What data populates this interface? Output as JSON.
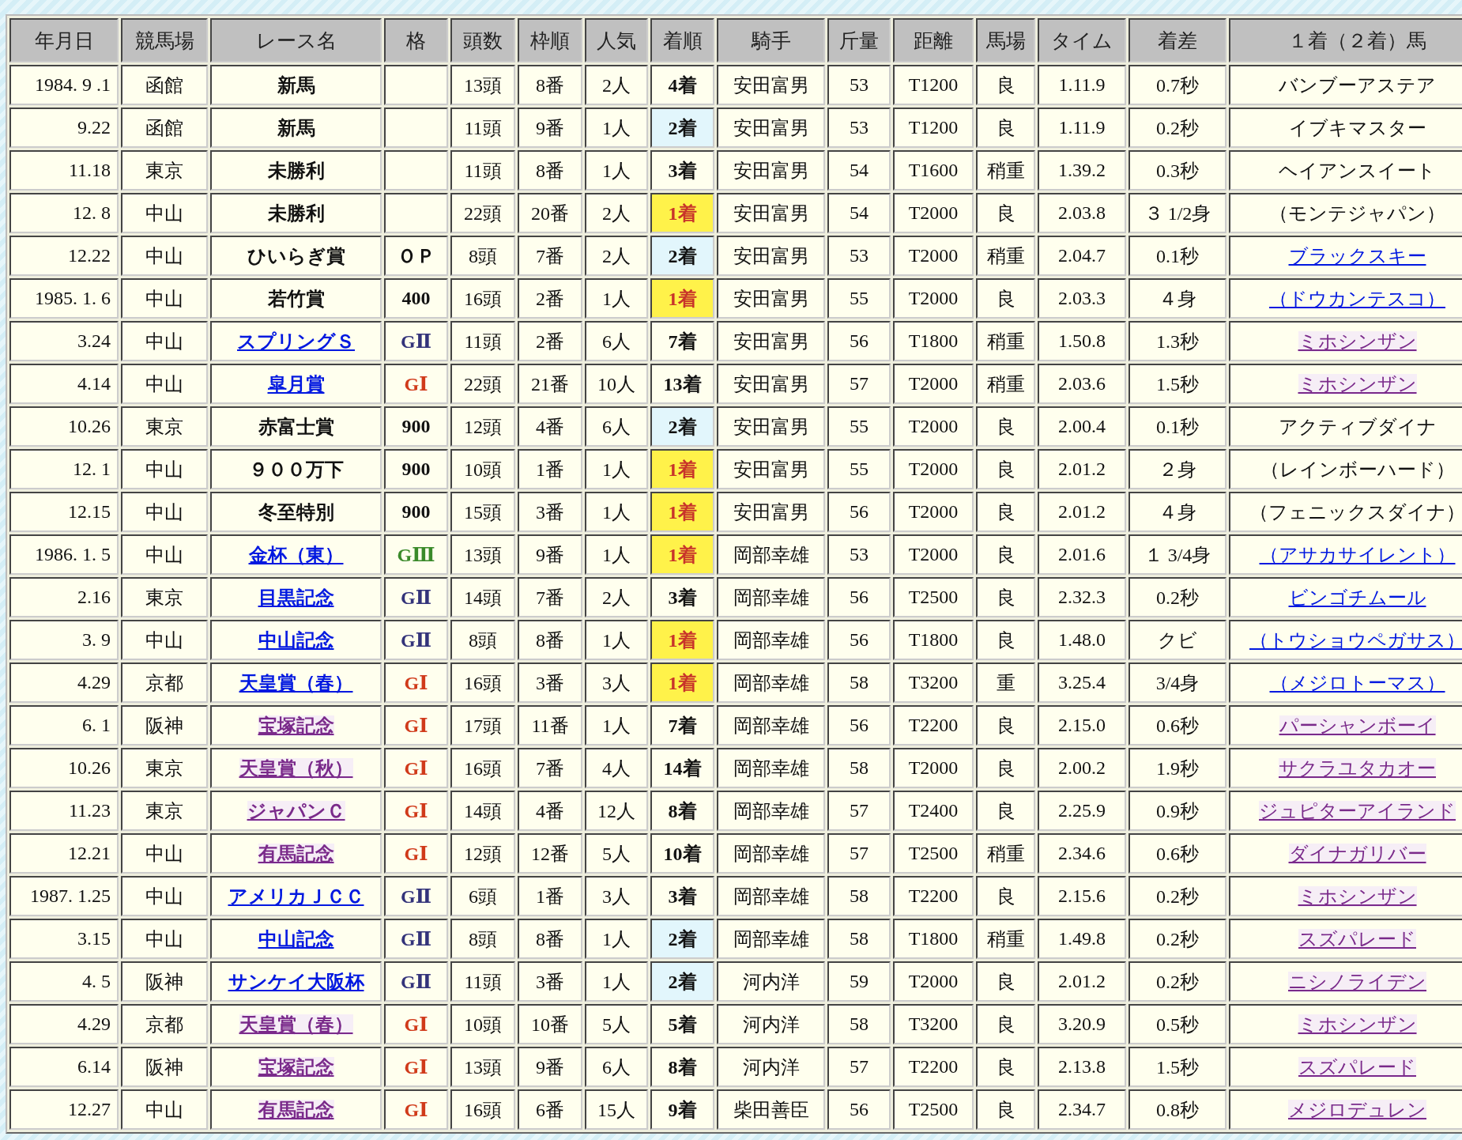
{
  "table": {
    "columns": [
      "年月日",
      "競馬場",
      "レース名",
      "格",
      "頭数",
      "枠順",
      "人気",
      "着順",
      "騎手",
      "斤量",
      "距離",
      "馬場",
      "タイム",
      "着差",
      "１着（２着）馬"
    ],
    "rows": [
      {
        "date": "1984. 9 .1",
        "course": "函館",
        "race": {
          "name": "新馬",
          "link": false
        },
        "runners": "13頭",
        "gate": "8番",
        "popularity": "2人",
        "finish": {
          "text": "4着",
          "kind": "plain"
        },
        "jockey": "安田富男",
        "weight": "53",
        "distance": "T1200",
        "going": "良",
        "time": "1.11.9",
        "margin": "0.7秒",
        "winner": {
          "name": "バンブーアステア",
          "link": false
        }
      },
      {
        "date": "9.22",
        "course": "函館",
        "race": {
          "name": "新馬",
          "link": false
        },
        "runners": "11頭",
        "gate": "9番",
        "popularity": "1人",
        "finish": {
          "text": "2着",
          "kind": "second"
        },
        "jockey": "安田富男",
        "weight": "53",
        "distance": "T1200",
        "going": "良",
        "time": "1.11.9",
        "margin": "0.2秒",
        "winner": {
          "name": "イブキマスター",
          "link": false
        }
      },
      {
        "date": "11.18",
        "course": "東京",
        "race": {
          "name": "未勝利",
          "link": false
        },
        "runners": "11頭",
        "gate": "8番",
        "popularity": "1人",
        "finish": {
          "text": "3着",
          "kind": "plain"
        },
        "jockey": "安田富男",
        "weight": "54",
        "distance": "T1600",
        "going": "稍重",
        "time": "1.39.2",
        "margin": "0.3秒",
        "winner": {
          "name": "ヘイアンスイート",
          "link": false
        }
      },
      {
        "date": "12. 8",
        "course": "中山",
        "race": {
          "name": "未勝利",
          "link": false
        },
        "runners": "22頭",
        "gate": "20番",
        "popularity": "2人",
        "finish": {
          "text": "1着",
          "kind": "win"
        },
        "jockey": "安田富男",
        "weight": "54",
        "distance": "T2000",
        "going": "良",
        "time": "2.03.8",
        "margin": "３ 1/2身",
        "winner": {
          "name": "（モンテジャパン）",
          "link": false
        }
      },
      {
        "date": "12.22",
        "course": "中山",
        "race": {
          "name": "ひいらぎ賞",
          "link": false
        },
        "grade": {
          "text": "ＯＰ",
          "kind": "plain"
        },
        "runners": "8頭",
        "gate": "7番",
        "popularity": "2人",
        "finish": {
          "text": "2着",
          "kind": "second"
        },
        "jockey": "安田富男",
        "weight": "53",
        "distance": "T2000",
        "going": "稍重",
        "time": "2.04.7",
        "margin": "0.1秒",
        "winner": {
          "name": "ブラックスキー",
          "link": true,
          "visited": false
        }
      },
      {
        "date": "1985. 1. 6",
        "course": "中山",
        "race": {
          "name": "若竹賞",
          "link": false
        },
        "grade": {
          "text": "400",
          "kind": "plain"
        },
        "runners": "16頭",
        "gate": "2番",
        "popularity": "1人",
        "finish": {
          "text": "1着",
          "kind": "win"
        },
        "jockey": "安田富男",
        "weight": "55",
        "distance": "T2000",
        "going": "良",
        "time": "2.03.3",
        "margin": "４身",
        "winner": {
          "name": "（ドウカンテスコ）",
          "link": true,
          "visited": false
        }
      },
      {
        "date": "3.24",
        "course": "中山",
        "race": {
          "name": "スプリングＳ",
          "link": true,
          "visited": false
        },
        "grade": {
          "text": "GⅡ",
          "kind": "g2"
        },
        "runners": "11頭",
        "gate": "2番",
        "popularity": "6人",
        "finish": {
          "text": "7着",
          "kind": "plain"
        },
        "jockey": "安田富男",
        "weight": "56",
        "distance": "T1800",
        "going": "稍重",
        "time": "1.50.8",
        "margin": "1.3秒",
        "winner": {
          "name": "ミホシンザン",
          "link": true,
          "visited": true
        }
      },
      {
        "date": "4.14",
        "course": "中山",
        "race": {
          "name": "皐月賞",
          "link": true,
          "visited": false
        },
        "grade": {
          "text": "GⅠ",
          "kind": "g1"
        },
        "runners": "22頭",
        "gate": "21番",
        "popularity": "10人",
        "finish": {
          "text": "13着",
          "kind": "plain"
        },
        "jockey": "安田富男",
        "weight": "57",
        "distance": "T2000",
        "going": "稍重",
        "time": "2.03.6",
        "margin": "1.5秒",
        "winner": {
          "name": "ミホシンザン",
          "link": true,
          "visited": true
        }
      },
      {
        "date": "10.26",
        "course": "東京",
        "race": {
          "name": "赤富士賞",
          "link": false
        },
        "grade": {
          "text": "900",
          "kind": "plain"
        },
        "runners": "12頭",
        "gate": "4番",
        "popularity": "6人",
        "finish": {
          "text": "2着",
          "kind": "second"
        },
        "jockey": "安田富男",
        "weight": "55",
        "distance": "T2000",
        "going": "良",
        "time": "2.00.4",
        "margin": "0.1秒",
        "winner": {
          "name": "アクティブダイナ",
          "link": false
        }
      },
      {
        "date": "12. 1",
        "course": "中山",
        "race": {
          "name": "９００万下",
          "link": false
        },
        "grade": {
          "text": "900",
          "kind": "plain"
        },
        "runners": "10頭",
        "gate": "1番",
        "popularity": "1人",
        "finish": {
          "text": "1着",
          "kind": "win"
        },
        "jockey": "安田富男",
        "weight": "55",
        "distance": "T2000",
        "going": "良",
        "time": "2.01.2",
        "margin": "２身",
        "winner": {
          "name": "（レインボーハード）",
          "link": false
        }
      },
      {
        "date": "12.15",
        "course": "中山",
        "race": {
          "name": "冬至特別",
          "link": false
        },
        "grade": {
          "text": "900",
          "kind": "plain"
        },
        "runners": "15頭",
        "gate": "3番",
        "popularity": "1人",
        "finish": {
          "text": "1着",
          "kind": "win"
        },
        "jockey": "安田富男",
        "weight": "56",
        "distance": "T2000",
        "going": "良",
        "time": "2.01.2",
        "margin": "４身",
        "winner": {
          "name": "（フェニックスダイナ）",
          "link": false
        }
      },
      {
        "date": "1986. 1. 5",
        "course": "中山",
        "race": {
          "name": "金杯（東）",
          "link": true,
          "visited": false
        },
        "grade": {
          "text": "GⅢ",
          "kind": "g3"
        },
        "runners": "13頭",
        "gate": "9番",
        "popularity": "1人",
        "finish": {
          "text": "1着",
          "kind": "win"
        },
        "jockey": "岡部幸雄",
        "weight": "53",
        "distance": "T2000",
        "going": "良",
        "time": "2.01.6",
        "margin": "１ 3/4身",
        "winner": {
          "name": "（アサカサイレント）",
          "link": true,
          "visited": false
        }
      },
      {
        "date": "2.16",
        "course": "東京",
        "race": {
          "name": "目黒記念",
          "link": true,
          "visited": false
        },
        "grade": {
          "text": "GⅡ",
          "kind": "g2"
        },
        "runners": "14頭",
        "gate": "7番",
        "popularity": "2人",
        "finish": {
          "text": "3着",
          "kind": "plain"
        },
        "jockey": "岡部幸雄",
        "weight": "56",
        "distance": "T2500",
        "going": "良",
        "time": "2.32.3",
        "margin": "0.2秒",
        "winner": {
          "name": "ビンゴチムール",
          "link": true,
          "visited": false
        }
      },
      {
        "date": "3. 9",
        "course": "中山",
        "race": {
          "name": "中山記念",
          "link": true,
          "visited": false
        },
        "grade": {
          "text": "GⅡ",
          "kind": "g2"
        },
        "runners": "8頭",
        "gate": "8番",
        "popularity": "1人",
        "finish": {
          "text": "1着",
          "kind": "win"
        },
        "jockey": "岡部幸雄",
        "weight": "56",
        "distance": "T1800",
        "going": "良",
        "time": "1.48.0",
        "margin": "クビ",
        "winner": {
          "name": "（トウショウペガサス）",
          "link": true,
          "visited": false
        }
      },
      {
        "date": "4.29",
        "course": "京都",
        "race": {
          "name": "天皇賞（春）",
          "link": true,
          "visited": false
        },
        "grade": {
          "text": "GⅠ",
          "kind": "g1"
        },
        "runners": "16頭",
        "gate": "3番",
        "popularity": "3人",
        "finish": {
          "text": "1着",
          "kind": "win"
        },
        "jockey": "岡部幸雄",
        "weight": "58",
        "distance": "T3200",
        "going": "重",
        "time": "3.25.4",
        "margin": "3/4身",
        "winner": {
          "name": "（メジロトーマス）",
          "link": true,
          "visited": false
        }
      },
      {
        "date": "6. 1",
        "course": "阪神",
        "race": {
          "name": "宝塚記念",
          "link": true,
          "visited": true
        },
        "grade": {
          "text": "GⅠ",
          "kind": "g1"
        },
        "runners": "17頭",
        "gate": "11番",
        "popularity": "1人",
        "finish": {
          "text": "7着",
          "kind": "plain"
        },
        "jockey": "岡部幸雄",
        "weight": "56",
        "distance": "T2200",
        "going": "良",
        "time": "2.15.0",
        "margin": "0.6秒",
        "winner": {
          "name": "パーシャンボーイ",
          "link": true,
          "visited": true
        }
      },
      {
        "date": "10.26",
        "course": "東京",
        "race": {
          "name": "天皇賞（秋）",
          "link": true,
          "visited": true
        },
        "grade": {
          "text": "GⅠ",
          "kind": "g1"
        },
        "runners": "16頭",
        "gate": "7番",
        "popularity": "4人",
        "finish": {
          "text": "14着",
          "kind": "plain"
        },
        "jockey": "岡部幸雄",
        "weight": "58",
        "distance": "T2000",
        "going": "良",
        "time": "2.00.2",
        "margin": "1.9秒",
        "winner": {
          "name": "サクラユタカオー",
          "link": true,
          "visited": true
        }
      },
      {
        "date": "11.23",
        "course": "東京",
        "race": {
          "name": "ジャパンＣ",
          "link": true,
          "visited": true
        },
        "grade": {
          "text": "GⅠ",
          "kind": "g1"
        },
        "runners": "14頭",
        "gate": "4番",
        "popularity": "12人",
        "finish": {
          "text": "8着",
          "kind": "plain"
        },
        "jockey": "岡部幸雄",
        "weight": "57",
        "distance": "T2400",
        "going": "良",
        "time": "2.25.9",
        "margin": "0.9秒",
        "winner": {
          "name": "ジュピターアイランド",
          "link": true,
          "visited": true
        }
      },
      {
        "date": "12.21",
        "course": "中山",
        "race": {
          "name": "有馬記念",
          "link": true,
          "visited": true
        },
        "grade": {
          "text": "GⅠ",
          "kind": "g1"
        },
        "runners": "12頭",
        "gate": "12番",
        "popularity": "5人",
        "finish": {
          "text": "10着",
          "kind": "plain"
        },
        "jockey": "岡部幸雄",
        "weight": "57",
        "distance": "T2500",
        "going": "稍重",
        "time": "2.34.6",
        "margin": "0.6秒",
        "winner": {
          "name": "ダイナガリバー",
          "link": true,
          "visited": true
        }
      },
      {
        "date": "1987. 1.25",
        "course": "中山",
        "race": {
          "name": "アメリカＪＣＣ",
          "link": true,
          "visited": false
        },
        "grade": {
          "text": "GⅡ",
          "kind": "g2"
        },
        "runners": "6頭",
        "gate": "1番",
        "popularity": "3人",
        "finish": {
          "text": "3着",
          "kind": "plain"
        },
        "jockey": "岡部幸雄",
        "weight": "58",
        "distance": "T2200",
        "going": "良",
        "time": "2.15.6",
        "margin": "0.2秒",
        "winner": {
          "name": "ミホシンザン",
          "link": true,
          "visited": true
        }
      },
      {
        "date": "3.15",
        "course": "中山",
        "race": {
          "name": "中山記念",
          "link": true,
          "visited": false
        },
        "grade": {
          "text": "GⅡ",
          "kind": "g2"
        },
        "runners": "8頭",
        "gate": "8番",
        "popularity": "1人",
        "finish": {
          "text": "2着",
          "kind": "second"
        },
        "jockey": "岡部幸雄",
        "weight": "58",
        "distance": "T1800",
        "going": "稍重",
        "time": "1.49.8",
        "margin": "0.2秒",
        "winner": {
          "name": "スズパレード",
          "link": true,
          "visited": true
        }
      },
      {
        "date": "4. 5",
        "course": "阪神",
        "race": {
          "name": "サンケイ大阪杯",
          "link": true,
          "visited": false
        },
        "grade": {
          "text": "GⅡ",
          "kind": "g2"
        },
        "runners": "11頭",
        "gate": "3番",
        "popularity": "1人",
        "finish": {
          "text": "2着",
          "kind": "second"
        },
        "jockey": "河内洋",
        "weight": "59",
        "distance": "T2000",
        "going": "良",
        "time": "2.01.2",
        "margin": "0.2秒",
        "winner": {
          "name": "ニシノライデン",
          "link": true,
          "visited": true
        }
      },
      {
        "date": "4.29",
        "course": "京都",
        "race": {
          "name": "天皇賞（春）",
          "link": true,
          "visited": true
        },
        "grade": {
          "text": "GⅠ",
          "kind": "g1"
        },
        "runners": "10頭",
        "gate": "10番",
        "popularity": "5人",
        "finish": {
          "text": "5着",
          "kind": "plain"
        },
        "jockey": "河内洋",
        "weight": "58",
        "distance": "T3200",
        "going": "良",
        "time": "3.20.9",
        "margin": "0.5秒",
        "winner": {
          "name": "ミホシンザン",
          "link": true,
          "visited": true
        }
      },
      {
        "date": "6.14",
        "course": "阪神",
        "race": {
          "name": "宝塚記念",
          "link": true,
          "visited": true
        },
        "grade": {
          "text": "GⅠ",
          "kind": "g1"
        },
        "runners": "13頭",
        "gate": "9番",
        "popularity": "6人",
        "finish": {
          "text": "8着",
          "kind": "plain"
        },
        "jockey": "河内洋",
        "weight": "57",
        "distance": "T2200",
        "going": "良",
        "time": "2.13.8",
        "margin": "1.5秒",
        "winner": {
          "name": "スズパレード",
          "link": true,
          "visited": true
        }
      },
      {
        "date": "12.27",
        "course": "中山",
        "race": {
          "name": "有馬記念",
          "link": true,
          "visited": true
        },
        "grade": {
          "text": "GⅠ",
          "kind": "g1"
        },
        "runners": "16頭",
        "gate": "6番",
        "popularity": "15人",
        "finish": {
          "text": "9着",
          "kind": "plain"
        },
        "jockey": "柴田善臣",
        "weight": "56",
        "distance": "T2500",
        "going": "良",
        "time": "2.34.7",
        "margin": "0.8秒",
        "winner": {
          "name": "メジロデュレン",
          "link": true,
          "visited": true
        }
      }
    ]
  }
}
